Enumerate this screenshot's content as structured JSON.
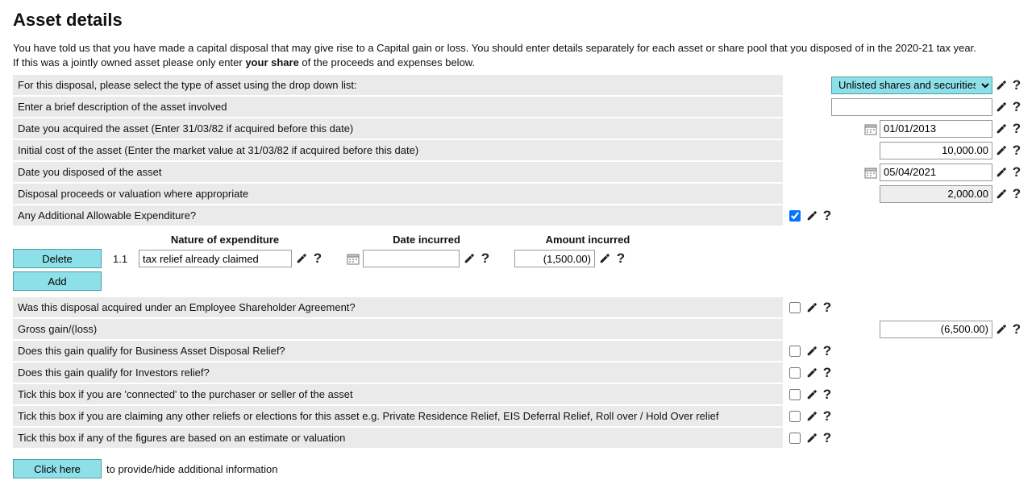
{
  "page_title": "Asset details",
  "intro_1": "You have told us that you have made a capital disposal that may give rise to a Capital gain or loss. You should enter details separately for each asset or share pool that you disposed of in the 2020-21 tax year. If this was a jointly owned asset please only enter ",
  "intro_bold": "your share",
  "intro_2": " of the proceeds and expenses below.",
  "rows": {
    "asset_type": {
      "label": "For this disposal, please select the type of asset using the drop down list:",
      "value": "Unlisted shares and securities"
    },
    "description": {
      "label": "Enter a brief description of the asset involved",
      "value": ""
    },
    "date_acq": {
      "label": "Date you acquired the asset (Enter 31/03/82 if acquired before this date)",
      "value": "01/01/2013"
    },
    "initial_cost": {
      "label": "Initial cost of the asset (Enter the market value at 31/03/82 if acquired before this date)",
      "value": "10,000.00"
    },
    "date_disp": {
      "label": "Date you disposed of the asset",
      "value": "05/04/2021"
    },
    "proceeds": {
      "label": "Disposal proceeds or valuation where appropriate",
      "value": "2,000.00"
    },
    "any_addl": {
      "label": "Any Additional Allowable Expenditure?"
    },
    "esa": {
      "label": "Was this disposal acquired under an Employee Shareholder Agreement?"
    },
    "gross": {
      "label": "Gross gain/(loss)",
      "value": "(6,500.00)"
    },
    "badr": {
      "label": "Does this gain qualify for Business Asset Disposal Relief?"
    },
    "investors": {
      "label": "Does this gain qualify for Investors relief?"
    },
    "connected": {
      "label": "Tick this box if you are 'connected' to the purchaser or seller of the asset"
    },
    "other_relief": {
      "label": "Tick this box if you are claiming any other reliefs or elections for this asset e.g. Private Residence Relief, EIS Deferral Relief, Roll over / Hold Over relief"
    },
    "estimate": {
      "label": "Tick this box if any of the figures are based on an estimate or valuation"
    }
  },
  "expend": {
    "head_nature": "Nature of expenditure",
    "head_date": "Date incurred",
    "head_amount": "Amount incurred",
    "delete_label": "Delete",
    "add_label": "Add",
    "idx": "1.1",
    "nature_value": "tax relief already claimed",
    "date_value": "",
    "amount_value": "(1,500.00)"
  },
  "clickhere": {
    "button": "Click here",
    "hint": "to provide/hide additional information"
  }
}
